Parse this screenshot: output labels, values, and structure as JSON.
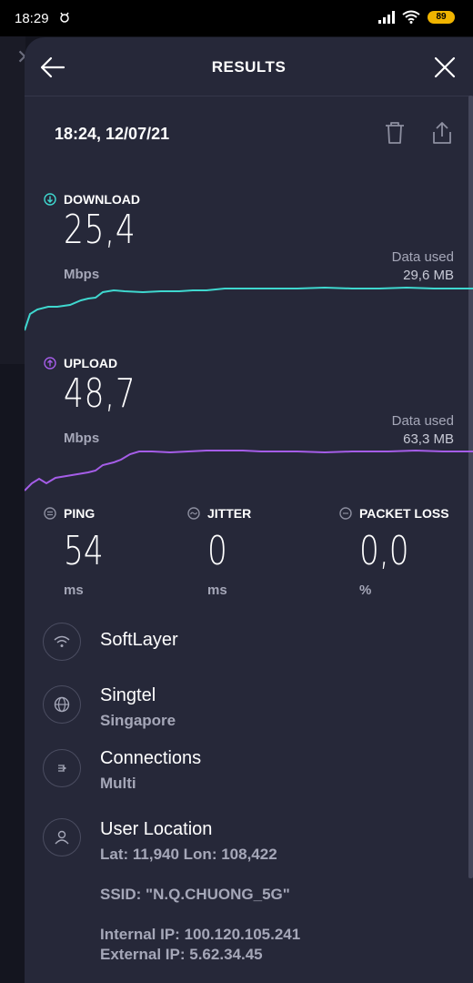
{
  "status_bar": {
    "time": "18:29",
    "battery": "89"
  },
  "header": {
    "title": "RESULTS"
  },
  "result": {
    "datetime": "18:24, 12/07/21"
  },
  "download": {
    "label": "DOWNLOAD",
    "value": "25,4",
    "unit": "Mbps",
    "data_used_label": "Data used",
    "data_used_value": "29,6 MB",
    "color": "#3fd8cf"
  },
  "upload": {
    "label": "UPLOAD",
    "value": "48,7",
    "unit": "Mbps",
    "data_used_label": "Data used",
    "data_used_value": "63,3 MB",
    "color": "#a55de8"
  },
  "ping": {
    "label": "PING",
    "value": "54",
    "unit": "ms"
  },
  "jitter": {
    "label": "JITTER",
    "value": "0",
    "unit": "ms"
  },
  "packet_loss": {
    "label": "PACKET LOSS",
    "value": "0,0",
    "unit": "%"
  },
  "server": {
    "name": "SoftLayer"
  },
  "provider": {
    "name": "Singtel",
    "location": "Singapore"
  },
  "connections": {
    "label": "Connections",
    "value": "Multi"
  },
  "user_location": {
    "label": "User Location",
    "coords": "Lat: 11,940 Lon: 108,422",
    "ssid": "SSID: \"N.Q.CHUONG_5G\"",
    "internal_ip": "Internal IP: 100.120.105.241",
    "external_ip": "External IP: 5.62.34.45"
  },
  "icons": {
    "back": "arrow-left-icon",
    "close": "close-icon",
    "delete": "trash-icon",
    "share": "share-icon",
    "download": "arrow-down-circle-icon",
    "upload": "arrow-up-circle-icon",
    "ping": "ping-icon",
    "jitter": "jitter-icon",
    "packet_loss": "packet-loss-icon",
    "server": "wifi-icon",
    "provider": "globe-icon",
    "connections": "connections-icon",
    "user": "user-icon"
  }
}
